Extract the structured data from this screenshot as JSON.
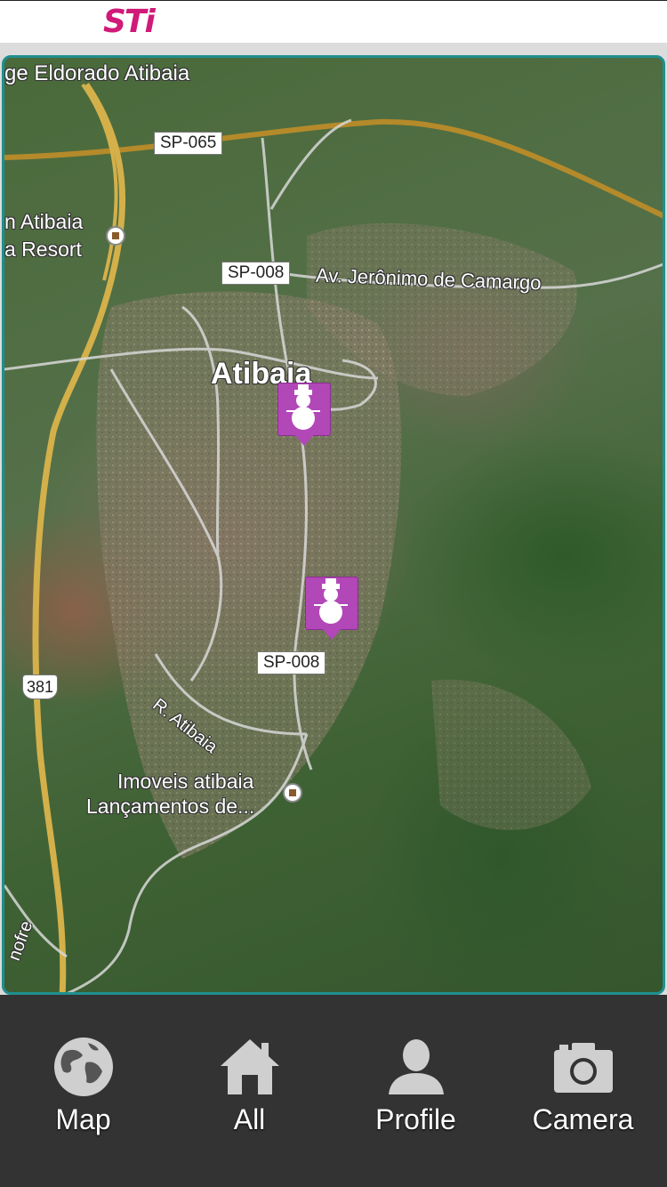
{
  "header": {
    "logo_text": "STi",
    "logo_color": "#d01a79"
  },
  "map": {
    "border_color": "#1f8f8f",
    "place_labels": {
      "eldorado": "ge Eldorado Atibaia",
      "resort_line1": "n Atibaia",
      "resort_line2": "a Resort",
      "city": "Atibaia",
      "avenue": "Av. Jerônimo de Camargo",
      "street": "R. Atibaia",
      "poi_line1": "Imoveis atibaia",
      "poi_line2": "Lançamentos de...",
      "river": "nofre"
    },
    "road_shields": {
      "sp065": "SP-065",
      "sp008_top": "SP-008",
      "sp008_bottom": "SP-008",
      "br381": "381"
    },
    "markers": [
      {
        "icon": "snowman-icon",
        "color": "#b247b8"
      },
      {
        "icon": "snowman-icon",
        "color": "#b247b8"
      }
    ]
  },
  "tabbar": {
    "background": "#333333",
    "tabs": [
      {
        "label": "Map",
        "icon": "globe-icon"
      },
      {
        "label": "All",
        "icon": "home-icon"
      },
      {
        "label": "Profile",
        "icon": "person-icon"
      },
      {
        "label": "Camera",
        "icon": "camera-icon"
      }
    ]
  }
}
